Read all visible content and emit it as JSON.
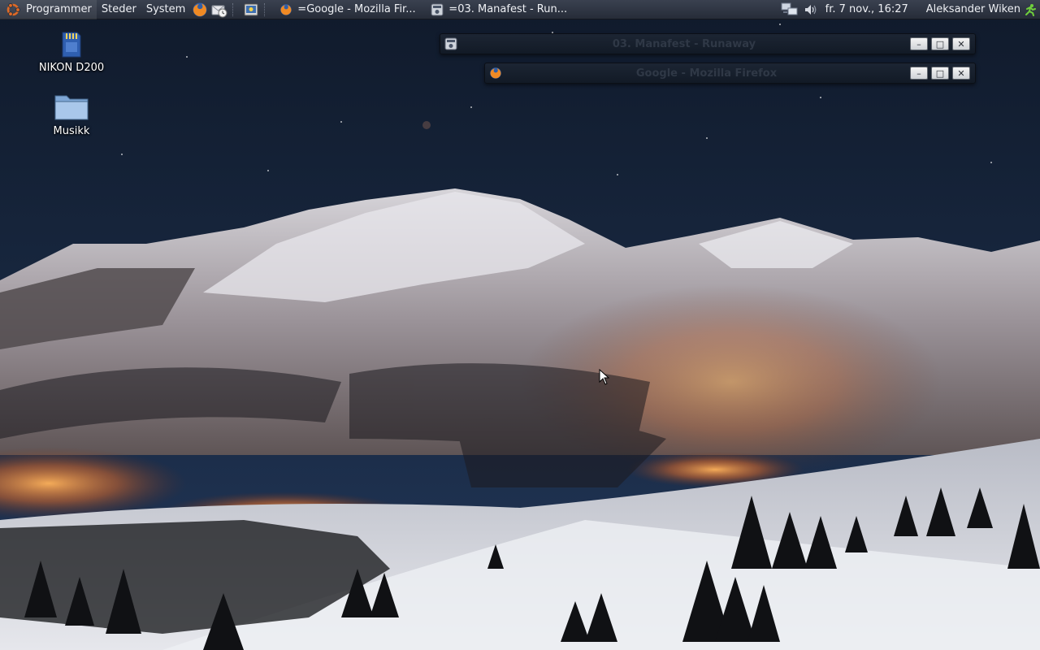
{
  "top_panel": {
    "menus": {
      "applications": "Programmer",
      "places": "Steder",
      "system": "System"
    },
    "launchers": [
      "firefox-icon",
      "mail-clock-icon",
      "screenshot-icon"
    ],
    "tasks": [
      {
        "icon": "firefox-icon",
        "label": "=Google - Mozilla Fir..."
      },
      {
        "icon": "media-player-icon",
        "label": "=03. Manafest - Run..."
      }
    ],
    "tray": [
      "network-icon",
      "volume-icon"
    ],
    "clock": "fr.  7 nov., 16:27",
    "user": "Aleksander Wiken",
    "user_icon": "running-man-icon"
  },
  "desktop_icons": [
    {
      "label": "NIKON D200",
      "icon": "sd-card-icon"
    },
    {
      "label": "Musikk",
      "icon": "folder-icon"
    }
  ],
  "windows": [
    {
      "title": "03. Manafest - Runaway",
      "icon": "media-player-icon",
      "buttons": [
        "minimize",
        "maximize",
        "close"
      ]
    },
    {
      "title": "Google - Mozilla Firefox",
      "icon": "firefox-icon",
      "buttons": [
        "minimize",
        "maximize",
        "close"
      ]
    }
  ],
  "colors": {
    "panel_bg": "#2f3542",
    "sky": "#16233a",
    "snow": "#c9ccd4",
    "village_lights": "#ff9a3c"
  }
}
